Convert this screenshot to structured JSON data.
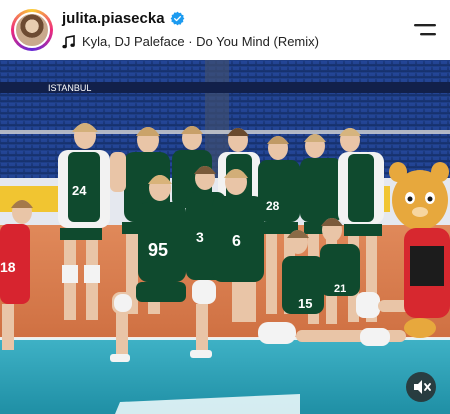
{
  "header": {
    "username": "julita.piasecka",
    "track": "Kyla, DJ Paleface · Do You Mind (Remix)"
  },
  "photo": {
    "banner_left": "ISTANBUL",
    "players": [
      {
        "number": "24"
      },
      {
        "number": "28"
      },
      {
        "number": "95"
      },
      {
        "number": "3"
      },
      {
        "number": "6"
      },
      {
        "number": "15"
      },
      {
        "number": "18"
      },
      {
        "number": "21"
      }
    ]
  },
  "colors": {
    "jersey": "#0f4a2e",
    "court": "#d87a4c",
    "court_blue": "#2aa3b8",
    "verified": "#1d9bf0"
  },
  "icons": [
    "verified-icon",
    "music-note-icon",
    "menu-icon",
    "mute-icon"
  ]
}
